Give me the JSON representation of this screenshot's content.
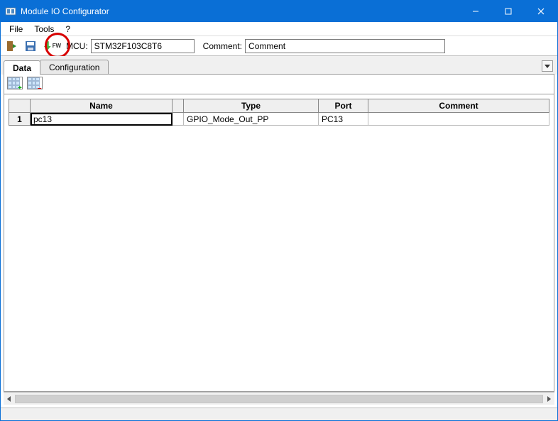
{
  "window": {
    "title": "Module IO Configurator"
  },
  "menu": {
    "file": "File",
    "tools": "Tools",
    "help": "?"
  },
  "toolbar": {
    "mcu_label": "MCU:",
    "mcu_value": "STM32F103C8T6",
    "comment_label": "Comment:",
    "comment_value": "Comment",
    "fw_badge": "FW"
  },
  "tabs": {
    "data": "Data",
    "configuration": "Configuration"
  },
  "grid": {
    "headers": {
      "row": "",
      "name": "Name",
      "spacer": "",
      "type": "Type",
      "port": "Port",
      "comment": "Comment"
    },
    "rows": [
      {
        "num": "1",
        "name": "pc13",
        "type": "GPIO_Mode_Out_PP",
        "port": "PC13",
        "comment": ""
      }
    ]
  }
}
